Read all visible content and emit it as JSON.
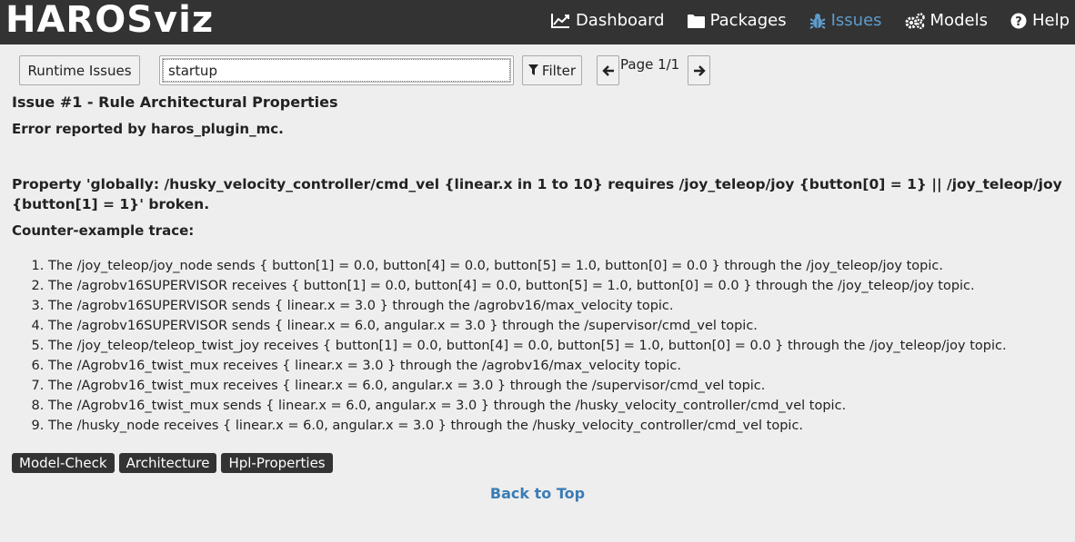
{
  "app": {
    "brand": "HAROSviz"
  },
  "nav": {
    "dashboard": "Dashboard",
    "packages": "Packages",
    "issues": "Issues",
    "models": "Models",
    "help": "Help",
    "active": "issues",
    "active_color": "#5e9ccc"
  },
  "toolbar": {
    "runtime_issues_label": "Runtime Issues",
    "search_value": "startup",
    "filter_label": "Filter",
    "page_label": "Page 1/1"
  },
  "issue": {
    "title": "Issue #1 - Rule Architectural Properties",
    "reporter": "Error reported by haros_plugin_mc.",
    "property": "Property 'globally: /husky_velocity_controller/cmd_vel {linear.x in 1 to 10} requires /joy_teleop/joy {button[0] = 1} || /joy_teleop/joy {button[1] = 1}' broken.",
    "trace_label": "Counter-example trace:",
    "trace": [
      "The /joy_teleop/joy_node sends { button[1] = 0.0, button[4] = 0.0, button[5] = 1.0, button[0] = 0.0 } through the /joy_teleop/joy topic.",
      "The /agrobv16SUPERVISOR receives { button[1] = 0.0, button[4] = 0.0, button[5] = 1.0, button[0] = 0.0 } through the /joy_teleop/joy topic.",
      "The /agrobv16SUPERVISOR sends { linear.x = 3.0 } through the /agrobv16/max_velocity topic.",
      "The /agrobv16SUPERVISOR sends { linear.x = 6.0, angular.x = 3.0 } through the /supervisor/cmd_vel topic.",
      "The /joy_teleop/teleop_twist_joy receives { button[1] = 0.0, button[4] = 0.0, button[5] = 1.0, button[0] = 0.0 } through the /joy_teleop/joy topic.",
      "The /Agrobv16_twist_mux receives { linear.x = 3.0 } through the /agrobv16/max_velocity topic.",
      "The /Agrobv16_twist_mux receives { linear.x = 6.0, angular.x = 3.0 } through the /supervisor/cmd_vel topic.",
      "The /Agrobv16_twist_mux sends { linear.x = 6.0, angular.x = 3.0 } through the /husky_velocity_controller/cmd_vel topic.",
      "The /husky_node receives { linear.x = 6.0, angular.x = 3.0 } through the /husky_velocity_controller/cmd_vel topic."
    ],
    "tags": [
      "Model-Check",
      "Architecture",
      "Hpl-Properties"
    ]
  },
  "footer": {
    "back_to_top": "Back to Top"
  }
}
